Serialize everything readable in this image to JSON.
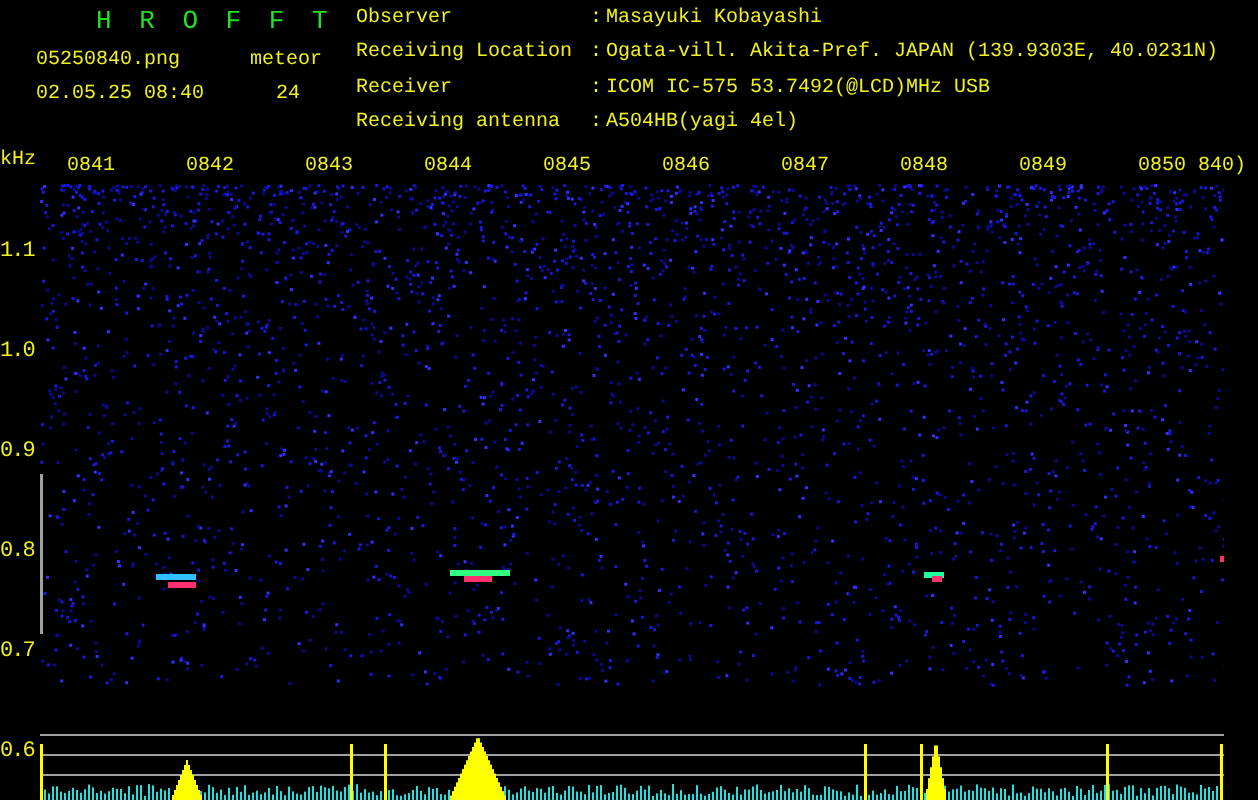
{
  "app_title": "H R O F F T",
  "file_name": "05250840.png",
  "timestamp": "02.05.25 08:40",
  "meteor": {
    "label": "meteor",
    "count": "24"
  },
  "info": [
    {
      "label": "Observer",
      "separator": ":",
      "value": "Masayuki Kobayashi"
    },
    {
      "label": "Receiving Location",
      "separator": ":",
      "value": "Ogata-vill. Akita-Pref. JAPAN (139.9303E, 40.0231N)"
    },
    {
      "label": "Receiver",
      "separator": ":",
      "value": "ICOM IC-575 53.7492(@LCD)MHz USB"
    },
    {
      "label": "Receiving antenna",
      "separator": ":",
      "value": "A504HB(yagi 4el)"
    }
  ],
  "spectrogram": {
    "unit": "kHz",
    "time_labels": [
      "0841",
      "0842",
      "0843",
      "0844",
      "0845",
      "0846",
      "0847",
      "0848",
      "0849",
      "0850",
      "840)"
    ],
    "frequency_labels": [
      "1.1",
      "1.0",
      "0.9",
      "0.8",
      "0.7",
      "0.6"
    ]
  }
}
